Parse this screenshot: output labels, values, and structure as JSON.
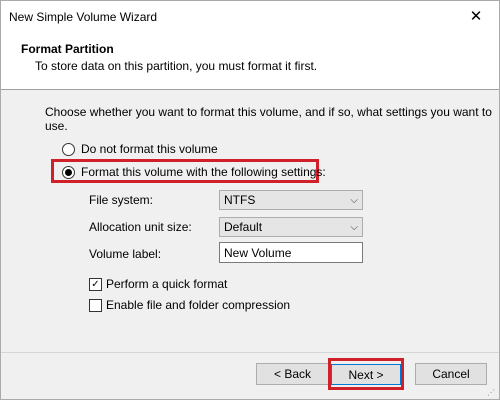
{
  "window": {
    "title": "New Simple Volume Wizard",
    "close_glyph": "✕"
  },
  "header": {
    "title": "Format Partition",
    "subtitle": "To store data on this partition, you must format it first."
  },
  "content": {
    "intro": "Choose whether you want to format this volume, and if so, what settings you want to use.",
    "options": {
      "no_format": "Do not format this volume",
      "format": "Format this volume with the following settings:",
      "selected": "format"
    },
    "fields": {
      "file_system_label": "File system:",
      "file_system_value": "NTFS",
      "allocation_label": "Allocation unit size:",
      "allocation_value": "Default",
      "volume_label_label": "Volume label:",
      "volume_label_value": "New Volume"
    },
    "checks": {
      "quick_format_label": "Perform a quick format",
      "quick_format_checked": true,
      "compression_label": "Enable file and folder compression",
      "compression_checked": false
    }
  },
  "footer": {
    "back_label": "< Back",
    "next_label": "Next >",
    "cancel_label": "Cancel"
  },
  "colors": {
    "highlight": "#d0202a",
    "background": "#f0f0f0",
    "header_bg": "#ffffff"
  },
  "icons": {
    "close": "close-icon",
    "dropdown": "chevron-down-icon",
    "check": "checkmark-icon"
  }
}
